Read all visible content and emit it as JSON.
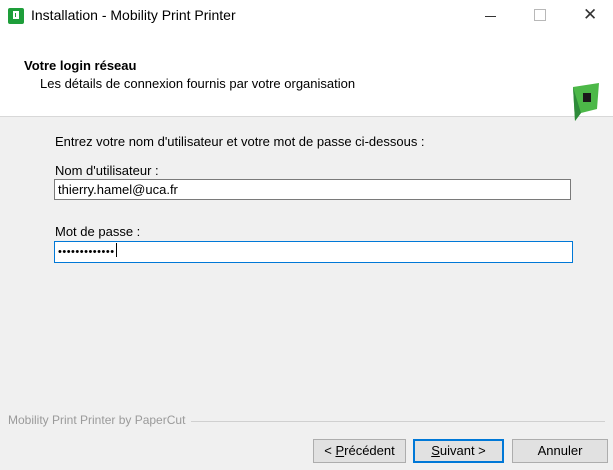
{
  "window": {
    "title": "Installation - Mobility Print Printer"
  },
  "header": {
    "title": "Votre login réseau",
    "subtitle": "Les détails de connexion fournis par votre organisation"
  },
  "form": {
    "instruction": "Entrez votre nom d'utilisateur et votre mot de passe ci-dessous :",
    "username_label": "Nom d'utilisateur :",
    "username_value": "thierry.hamel@uca.fr",
    "password_label": "Mot de passe :",
    "password_value": "•••••••••••••"
  },
  "footer": {
    "brand": "Mobility Print Printer by PaperCut",
    "prev": {
      "prefix": "< ",
      "accel": "P",
      "rest": "récédent"
    },
    "next": {
      "accel": "S",
      "rest": "uivant >"
    },
    "cancel": "Annuler"
  },
  "colors": {
    "accent": "#0078d7",
    "brand_green": "#1e9e3a"
  },
  "icons": {
    "app": "papercut-app-icon",
    "logo": "papercut-logo-icon"
  }
}
